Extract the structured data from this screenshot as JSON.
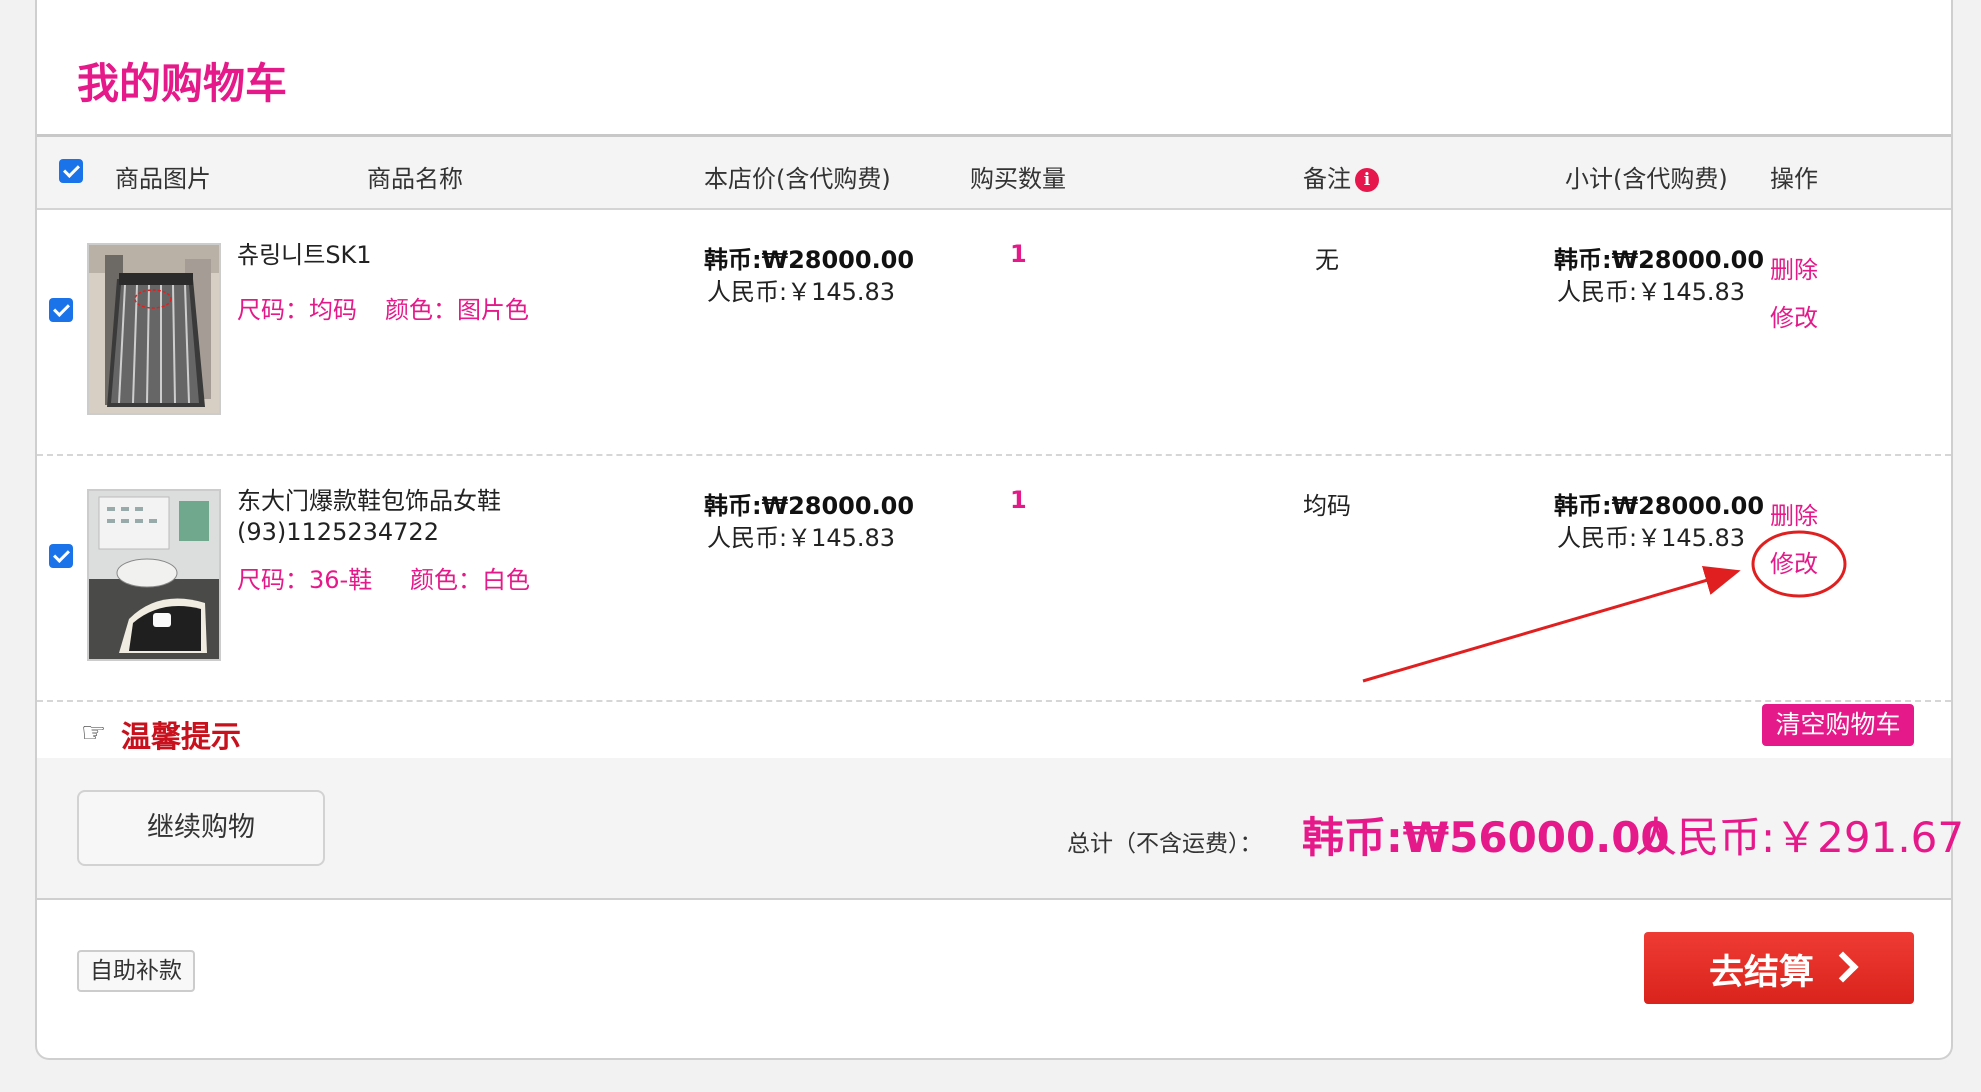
{
  "page": {
    "title": "我的购物车"
  },
  "table_header": {
    "image": "商品图片",
    "name": "商品名称",
    "unit_price": "本店价(含代购费)",
    "quantity": "购买数量",
    "remark": "备注",
    "subtotal": "小计(含代购费)",
    "actions": "操作",
    "select_all_checked": true,
    "remark_info_icon": "info-icon"
  },
  "items": [
    {
      "checked": true,
      "name": "츄링니트SK1",
      "size_text": "尺码：均码",
      "color_text": "颜色：图片色",
      "price_krw": "韩币:₩28000.00",
      "price_cny": "人民币:￥145.83",
      "quantity": "1",
      "remark": "无",
      "subtotal_krw": "韩币:₩28000.00",
      "subtotal_cny": "人民币:￥145.83",
      "delete_label": "删除",
      "edit_label": "修改"
    },
    {
      "checked": true,
      "name_line1": "东大门爆款鞋包饰品女鞋",
      "name_line2": "(93)1125234722",
      "size_text": "尺码：36-鞋",
      "color_text": "颜色：白色",
      "price_krw": "韩币:₩28000.00",
      "price_cny": "人民币:￥145.83",
      "quantity": "1",
      "remark": "均码",
      "subtotal_krw": "韩币:₩28000.00",
      "subtotal_cny": "人民币:￥145.83",
      "delete_label": "删除",
      "edit_label": "修改"
    }
  ],
  "tips": {
    "label": "温馨提示",
    "icon": "pointing-hand-icon"
  },
  "clear_cart_label": "清空购物车",
  "continue_label": "继续购物",
  "total": {
    "label": "总计（不含运费）：",
    "krw": "韩币:₩56000.00",
    "cny": "人民币:￥291.67"
  },
  "self_pay_label": "自助补款",
  "checkout_label": "去结算",
  "colors": {
    "brand_pink": "#e5198a",
    "checkout_red": "#e0261e",
    "tip_red": "#c8111d",
    "annotation_red": "#e02020"
  }
}
